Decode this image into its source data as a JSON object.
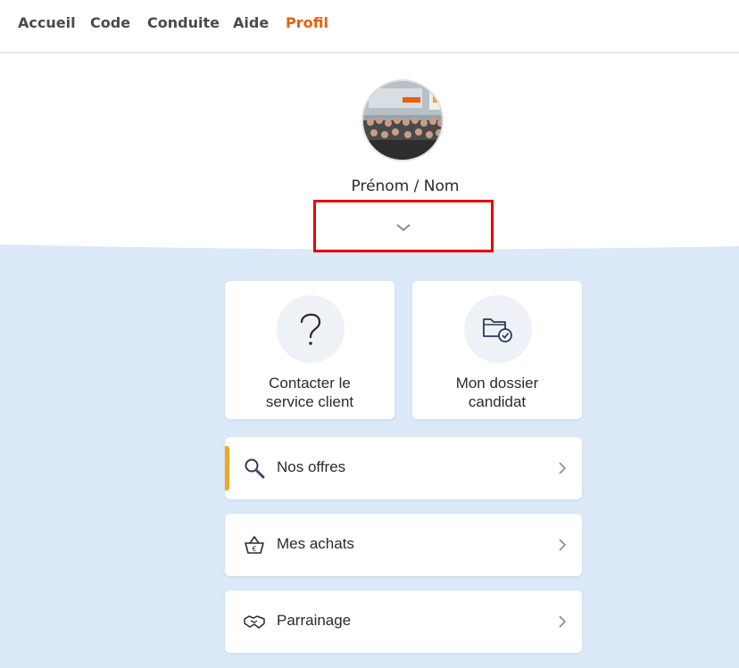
{
  "nav": {
    "items": [
      {
        "label": "Accueil"
      },
      {
        "label": "Code"
      },
      {
        "label": "Conduite"
      },
      {
        "label": "Aide"
      },
      {
        "label": "Profil"
      }
    ],
    "active": "Profil",
    "active_color": "#e8600c"
  },
  "profile": {
    "avatar_icon": "group-photo-avatar",
    "name_label": "Prénom / Nom",
    "expand_icon": "chevron-down-icon"
  },
  "tiles": [
    {
      "label_line1": "Contacter le",
      "label_line2": "service client",
      "icon": "question-mark-icon"
    },
    {
      "label_line1": "Mon dossier",
      "label_line2": "candidat",
      "icon": "folder-check-icon"
    }
  ],
  "rows": [
    {
      "label": "Nos offres",
      "icon": "magnifier-icon"
    },
    {
      "label": "Mes achats",
      "icon": "basket-euro-icon"
    },
    {
      "label": "Parrainage",
      "icon": "handshake-icon"
    }
  ],
  "colors": {
    "background": "#dbe9f8",
    "accent": "#f5a623",
    "highlight_box": "#e8000b"
  }
}
